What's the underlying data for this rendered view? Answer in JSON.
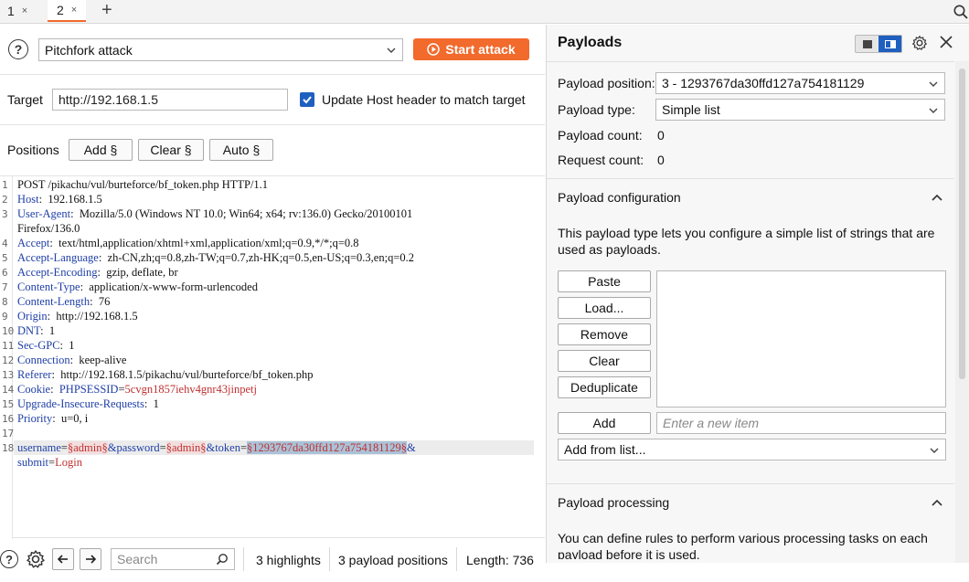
{
  "tabs": [
    {
      "label": "1",
      "close": "×"
    },
    {
      "label": "2",
      "close": "×"
    }
  ],
  "new_tab": "+",
  "attack": {
    "help": "?",
    "type": "Pitchfork attack",
    "start_label": "Start attack"
  },
  "target": {
    "label": "Target",
    "value": "http://192.168.1.5",
    "update_host_label": "Update Host header to match target",
    "update_host_checked": true
  },
  "positions": {
    "label": "Positions",
    "add": "Add §",
    "clear": "Clear §",
    "auto": "Auto §"
  },
  "request": {
    "line_numbers": [
      "1",
      "2",
      "3",
      "",
      "4",
      "5",
      "6",
      "7",
      "8",
      "9",
      "10",
      "11",
      "12",
      "13",
      "14",
      "15",
      "16",
      "17",
      "",
      "18",
      ""
    ],
    "request_line": "POST /pikachu/vul/burteforce/bf_token.php HTTP/1.1",
    "headers": [
      {
        "name": "Host",
        "value": "192.168.1.5"
      },
      {
        "name": "User-Agent",
        "value": "Mozilla/5.0 (Windows NT 10.0; Win64; x64; rv:136.0) Gecko/20100101"
      },
      {
        "name": "",
        "value": "Firefox/136.0"
      },
      {
        "name": "Accept",
        "value": "text/html,application/xhtml+xml,application/xml;q=0.9,*/*;q=0.8"
      },
      {
        "name": "Accept-Language",
        "value": "zh-CN,zh;q=0.8,zh-TW;q=0.7,zh-HK;q=0.5,en-US;q=0.3,en;q=0.2"
      },
      {
        "name": "Accept-Encoding",
        "value": "gzip, deflate, br"
      },
      {
        "name": "Content-Type",
        "value": "application/x-www-form-urlencoded"
      },
      {
        "name": "Content-Length",
        "value": "76"
      },
      {
        "name": "Origin",
        "value": "http://192.168.1.5"
      },
      {
        "name": "DNT",
        "value": "1"
      },
      {
        "name": "Sec-GPC",
        "value": "1"
      },
      {
        "name": "Connection",
        "value": "keep-alive"
      },
      {
        "name": "Referer",
        "value": "http://192.168.1.5/pikachu/vul/burteforce/bf_token.php"
      },
      {
        "name": "Cookie",
        "value": "PHPSESSID=5cvgn1857iehv4gnr43jinpetj"
      },
      {
        "name": "Upgrade-Insecure-Requests",
        "value": "1"
      },
      {
        "name": "Priority",
        "value": "u=0, i"
      }
    ],
    "cookie_name": "PHPSESSID",
    "cookie_value": "5cvgn1857iehv4gnr43jinpetj",
    "body": {
      "p1_name": "username",
      "p1_value": "§admin§",
      "p2_name": "&password",
      "p2_value": "§admin§",
      "p3_name": "&token",
      "p3_value": "§1293767da30ffd127a754181129§",
      "tail": "&",
      "line2_name": "submit",
      "line2_value": "Login"
    }
  },
  "status": {
    "help": "?",
    "search_placeholder": "Search",
    "highlights": "3 highlights",
    "payload_positions": "3 payload positions",
    "length": "Length: 736"
  },
  "payloads": {
    "title": "Payloads",
    "position_label": "Payload position:",
    "position_value": "3 - 1293767da30ffd127a754181129",
    "type_label": "Payload type:",
    "type_value": "Simple list",
    "count_label": "Payload count:",
    "count_value": "0",
    "request_count_label": "Request count:",
    "request_count_value": "0"
  },
  "config": {
    "title": "Payload configuration",
    "description": "This payload type lets you configure a simple list of strings that are used as payloads.",
    "buttons": [
      "Paste",
      "Load...",
      "Remove",
      "Clear",
      "Deduplicate"
    ],
    "add_label": "Add",
    "add_placeholder": "Enter a new item",
    "add_from_list": "Add from list..."
  },
  "processing": {
    "title": "Payload processing",
    "description": "You can define rules to perform various processing tasks on each payload before it is used."
  },
  "colors": {
    "accent": "#f26a2c",
    "checkbox": "#1f5fbf",
    "selection": "#aac2d8"
  }
}
